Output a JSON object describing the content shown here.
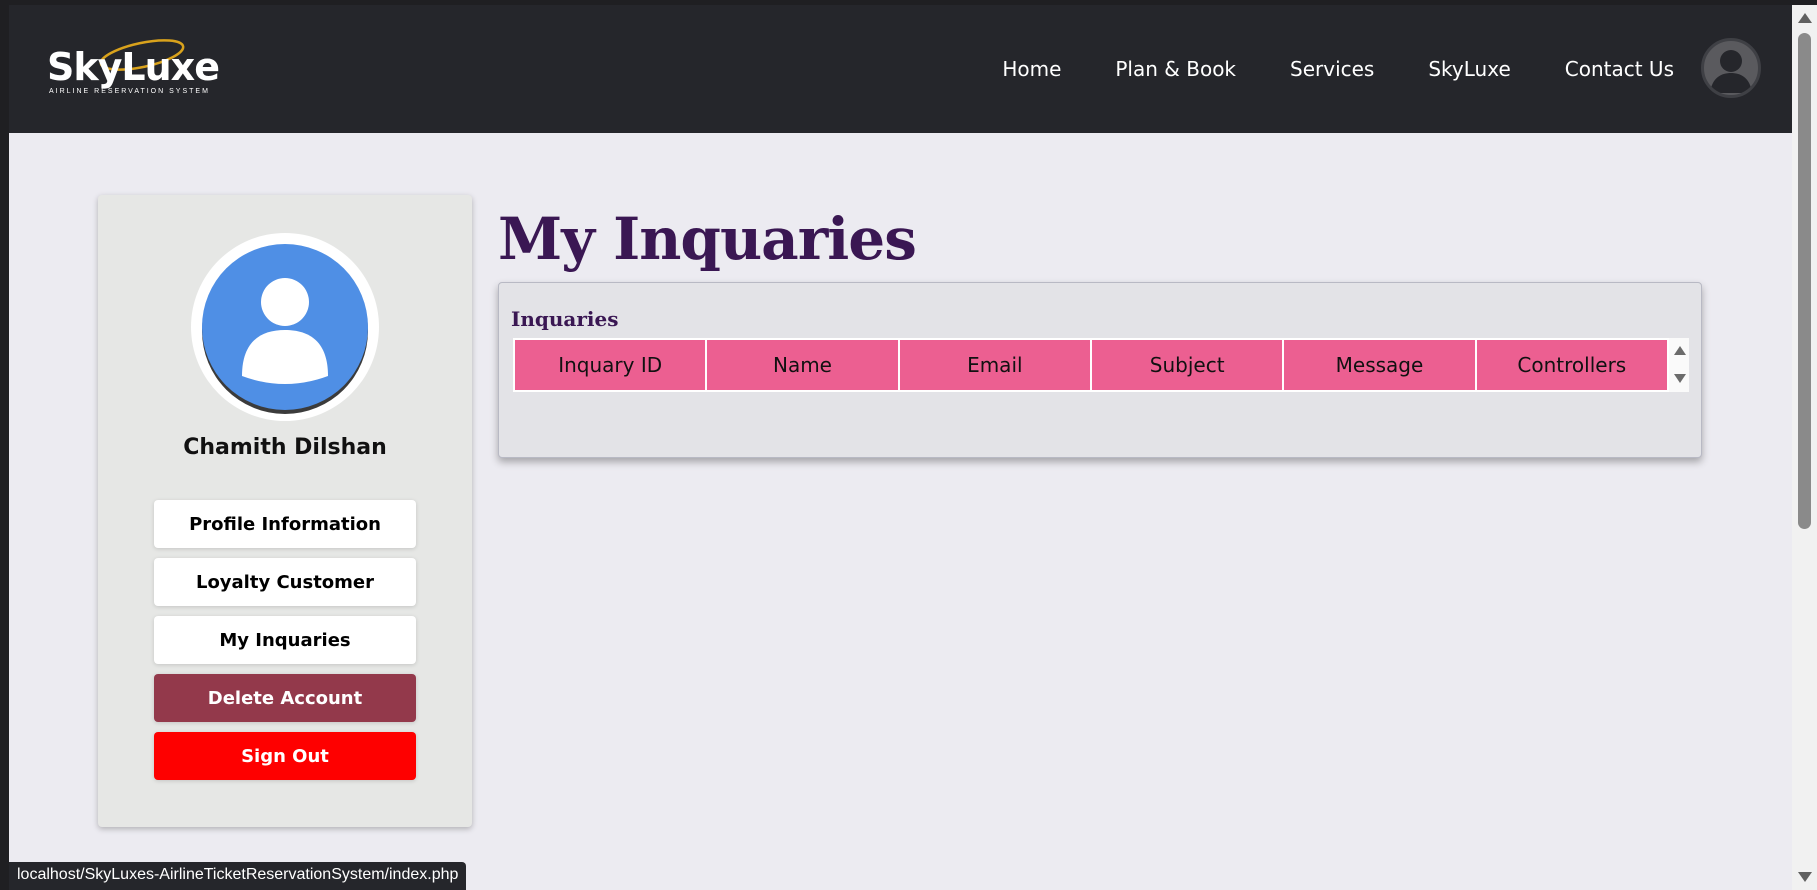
{
  "brand": {
    "name": "SkyLuxe",
    "tagline": "AIRLINE RESERVATION SYSTEM"
  },
  "nav": {
    "links": [
      "Home",
      "Plan & Book",
      "Services",
      "SkyLuxe",
      "Contact Us"
    ]
  },
  "sidebar": {
    "user_name": "Chamith Dilshan",
    "buttons": {
      "profile": "Profile Information",
      "loyalty": "Loyalty Customer",
      "inquaries": "My Inquaries",
      "delete": "Delete Account",
      "signout": "Sign Out"
    }
  },
  "main": {
    "title": "My Inquaries",
    "panel_title": "Inquaries",
    "columns": [
      "Inquary ID",
      "Name",
      "Email",
      "Subject",
      "Message",
      "Controllers"
    ]
  },
  "status_bar": {
    "url": "localhost/SkyLuxes-AirlineTicketReservationSystem/index.php"
  },
  "colors": {
    "navbar": "#25262b",
    "accent_title": "#3a1753",
    "table_header": "#ec5f91",
    "delete_button": "#93394b",
    "signout_button": "#fe0000",
    "avatar_blue": "#4f8fe5"
  }
}
